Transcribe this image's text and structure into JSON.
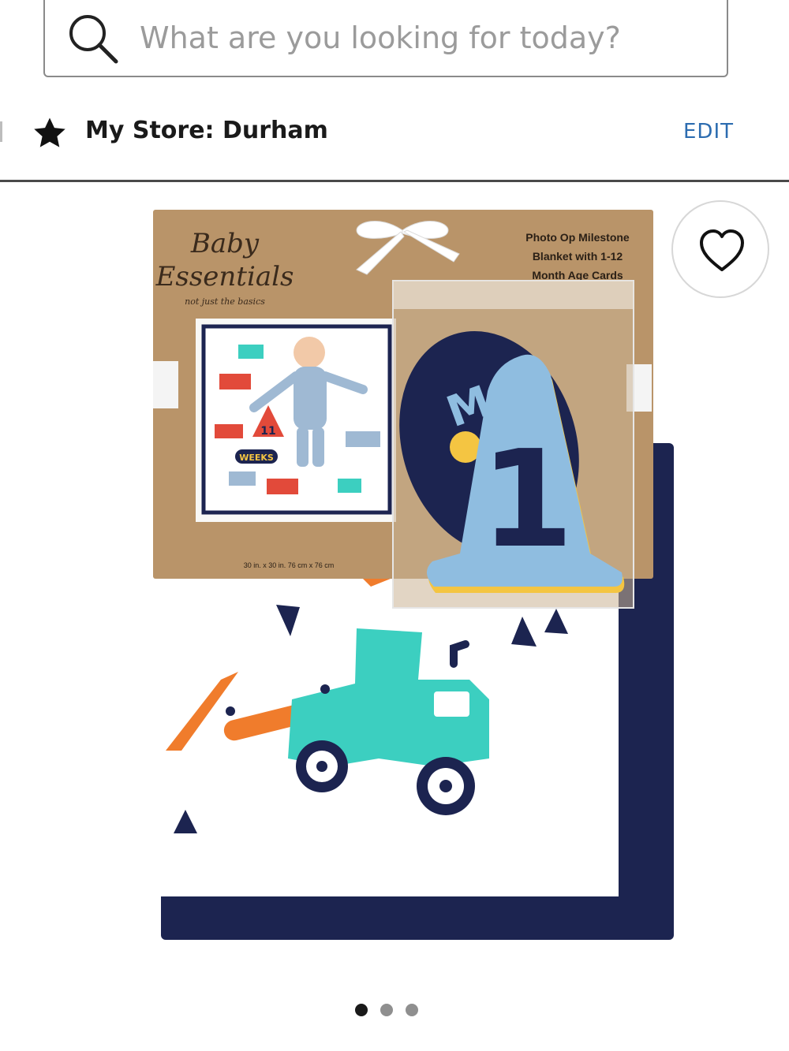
{
  "search": {
    "placeholder": "What are you looking for today?"
  },
  "store": {
    "label": "My Store: Durham",
    "edit_label": "EDIT"
  },
  "product": {
    "brand": "Baby Essentials",
    "brand_tagline": "not just the basics",
    "package_title": "Photo Op Milestone Blanket with 1-12 Month Age Cards",
    "package_title_lines": [
      "Photo Op Milestone",
      "Blanket with 1-12",
      "Month Age Cards"
    ],
    "size_text": "30 in. x 30 in.   76 cm x 76 cm",
    "photo_badge_number": "11",
    "photo_badge_text": "WEEKS",
    "card_number": "1",
    "card_letters": "MO"
  },
  "carousel": {
    "count": 3,
    "active_index": 0
  },
  "icons": {
    "search": "search-icon",
    "store": "star-icon",
    "wishlist": "heart-icon"
  },
  "colors": {
    "edit_link": "#2c6cb0",
    "navy_trim": "#1c2450",
    "kraft": "#b99469",
    "teal": "#3ccfc0",
    "orange": "#f07c2c",
    "card_blue": "#8fbde0"
  }
}
